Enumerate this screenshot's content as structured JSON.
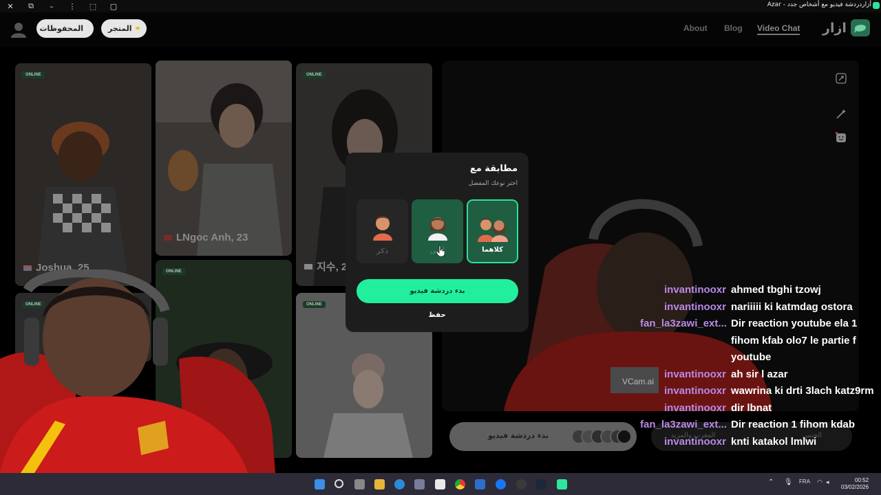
{
  "window": {
    "title": "أزاردردشة فيديو مع أشخاص جدد - Azar",
    "controls": [
      "close",
      "restore",
      "minimize",
      "more",
      "extensions",
      "tab"
    ]
  },
  "header": {
    "saved_label": "المحفوظات",
    "store_label": "المتجر",
    "nav": {
      "about": "About",
      "blog": "Blog",
      "video_chat": "Video Chat"
    },
    "brand_word": "ازار"
  },
  "gallery": {
    "badge": "ONLINE",
    "cards": [
      {
        "name": "Joshua, 25",
        "flag": "us"
      },
      {
        "name": "LNgoc Anh, 23",
        "flag": "vn"
      },
      {
        "name": "지수, 2",
        "flag": "kr"
      }
    ]
  },
  "modal": {
    "title": "مطابقة مع",
    "subtitle": "اختر نوعك المفضل",
    "options": {
      "male": "ذكر",
      "female": "أنثى",
      "both": "كلاهما"
    },
    "selected": "both",
    "start_button": "بدء دردشة فيديو",
    "save_link": "حفظ"
  },
  "bottom_bar": {
    "start_label": "بدء دردشة فيديو",
    "region_label": "المغرب والمزيد",
    "gender_label": "الجنس"
  },
  "video_overlay": {
    "watermark": "VCam.ai"
  },
  "chat": [
    {
      "user": "invantinooxr",
      "message": "ahmed tbghi tzowj"
    },
    {
      "user": "invantinooxr",
      "message": "nariiiii ki katmdag ostora"
    },
    {
      "user": "fan_la3zawi_ext...",
      "message": "Dir reaction youtube ela 1 fihom kfab olo7 le partie f youtube"
    },
    {
      "user": "invantinooxr",
      "message": "ah sir l azar"
    },
    {
      "user": "invantinooxr",
      "message": "wawrina ki drti 3lach katz9rm"
    },
    {
      "user": "invantinooxr",
      "message": "dir lbnat"
    },
    {
      "user": "fan_la3zawi_ext...",
      "message": "Dir reaction 1 fihom kdab"
    },
    {
      "user": "invantinooxr",
      "message": "knti katakol lmlwi"
    }
  ],
  "taskbar": {
    "language": "FRA",
    "time": "00:52",
    "date": "03/02/2026"
  },
  "colors": {
    "accent_green": "#22ef9d",
    "selected_card": "#1f5e41",
    "chat_username": "#b98ae8",
    "taskbar": "#2e2b38"
  }
}
